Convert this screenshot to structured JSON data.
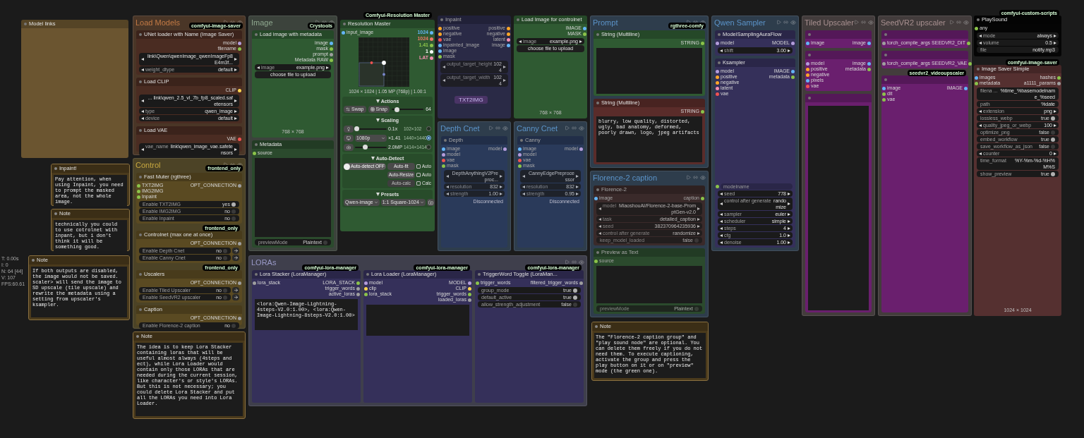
{
  "canvas_items": [
    {
      "kind": "node",
      "title": "Model links",
      "color": "#6b5530"
    },
    {
      "kind": "group",
      "title": "Load Models",
      "color": "#c27a45",
      "badge": "comfyui-image-saver",
      "nodes": [
        {
          "title": "UNet loader with Name (Image Saver)",
          "color": "#4a2c22",
          "outputs": [
            {
              "label": "model",
              "color": "#b39ddb"
            },
            {
              "label": "filename",
              "color": "#8bc34a"
            }
          ],
          "widgets": [
            {
              "kind": "combo",
              "value": "link\\Qwen\\qwenImage_qwenImageFp8E4m3f..."
            },
            {
              "kind": "combo",
              "label": "weight_dtype",
              "value": "default"
            }
          ]
        },
        {
          "title": "Load CLIP",
          "color": "#4a2c22",
          "outputs": [
            {
              "label": "CLIP",
              "color": "#ffd54f"
            }
          ],
          "widgets": [
            {
              "kind": "combo",
              "value": "... link\\qwen_2.5_vl_7b_fp8_scaled.safetensors"
            },
            {
              "kind": "combo",
              "label": "type",
              "value": "qwen_image"
            },
            {
              "kind": "combo",
              "label": "device",
              "value": "default"
            }
          ]
        },
        {
          "title": "Load VAE",
          "color": "#4a2c22",
          "outputs": [
            {
              "label": "VAE",
              "color": "#ef5350"
            }
          ],
          "widgets": [
            {
              "kind": "combo",
              "label": "vae_name",
              "value": "link\\qwen_image_vae.safetensors"
            }
          ]
        }
      ]
    },
    {
      "kind": "group",
      "title": "Image",
      "color": "#8fa88f",
      "badge": "Crystools",
      "nodes": [
        {
          "title": "Load image with metadata",
          "color": "#2f5a32",
          "outputs": [
            {
              "label": "image",
              "color": "#64b5f6"
            },
            {
              "label": "mask",
              "color": "#8bc34a"
            },
            {
              "label": "prompt",
              "color": "#9e9e9e"
            },
            {
              "label": "Metadata RAW",
              "color": "#8bc34a"
            }
          ],
          "widgets": [
            {
              "kind": "combo",
              "label": "image",
              "value": "example.png"
            },
            {
              "kind": "button",
              "label": "choose file to upload"
            }
          ],
          "footer": "768 × 768"
        },
        {
          "kind": "text",
          "title": "Metadata",
          "color": "#2b4a2d",
          "inputs": [
            {
              "label": "source",
              "color": "#8bc34a"
            }
          ],
          "bottom_widgets": [
            {
              "kind": "toggle",
              "label": "previewMode",
              "value": "Plaintext",
              "on": false
            }
          ]
        }
      ]
    },
    {
      "kind": "resolution_master",
      "title": "Resolution Master",
      "badge": "Comfyui-Resolution Master",
      "color": "#2f5a32",
      "inputs": [
        {
          "label": "input_image",
          "color": "#64b5f6"
        }
      ],
      "outputs": [
        {
          "label": "1024",
          "color": "#64b5f6"
        },
        {
          "label": "1024",
          "color": "#ef7a6a"
        },
        {
          "label": "1.41",
          "color": "#8bc34a"
        },
        {
          "label": "1",
          "color": "#ffffff"
        },
        {
          "label": "LAT",
          "color": "#f48fb1"
        }
      ],
      "info": "1024 × 1024 | 1.05 MP (768p) | 1.00:1",
      "actions": {
        "title": "Actions",
        "buttons": [
          "Swap",
          "Snap"
        ],
        "level": 0.15,
        "value": "64"
      },
      "scaling": {
        "title": "Scaling",
        "rows": [
          {
            "kind": "slider",
            "level": 0.05,
            "value": "0.1x",
            "dims": "102×102",
            "selected": false
          },
          {
            "kind": "dropdown",
            "option": "1080p",
            "value": "×1.41",
            "dims": "1440×1440",
            "selected": true
          },
          {
            "kind": "slider",
            "level": 0.3,
            "value": "2.0MP",
            "dims": "1414×1414",
            "selected": false
          }
        ]
      },
      "auto_detect": {
        "title": "Auto-Detect",
        "toggle": {
          "label": "Auto-detect OFF",
          "on": false
        },
        "buttons": [
          {
            "label": "Auto-fit",
            "checkbox": "Auto",
            "checked": false,
            "disabled": false
          },
          {
            "label": "Auto-Resize",
            "checkbox": "Auto",
            "checked": false,
            "disabled": false
          },
          {
            "label": "Auto-calc",
            "checkbox": "Calc",
            "checked": false,
            "disabled": true
          }
        ]
      },
      "presets": {
        "title": "Presets",
        "dropdowns": [
          "Qwen-image",
          "1:1 Square-1024"
        ]
      }
    },
    {
      "kind": "node",
      "title": "Inpaint",
      "color": "#2a2a46",
      "muted": true,
      "tag": "TXT2IMG",
      "inputs": [
        {
          "label": "positive",
          "color": "#ffa726"
        },
        {
          "label": "negative",
          "color": "#ffa726"
        },
        {
          "label": "vae",
          "color": "#ef5350"
        },
        {
          "label": "inpainted_image",
          "color": "#64b5f6"
        },
        {
          "label": "image",
          "color": "#64b5f6"
        },
        {
          "label": "mask",
          "color": "#8bc34a"
        }
      ],
      "outputs": [
        {
          "label": "positive",
          "color": "#ffa726"
        },
        {
          "label": "negative",
          "color": "#ffa726"
        },
        {
          "label": "latent",
          "color": "#f48fb1"
        },
        {
          "label": "image",
          "color": "#64b5f6"
        }
      ],
      "widgets": [
        {
          "kind": "number",
          "label": "output_target_height",
          "value": "1024"
        },
        {
          "kind": "number",
          "label": "output_target_width",
          "value": "1024"
        }
      ]
    },
    {
      "kind": "node",
      "title": "Load Image for controlnet",
      "color": "#2f5a32",
      "outputs": [
        {
          "label": "IMAGE",
          "color": "#64b5f6"
        },
        {
          "label": "MASK",
          "color": "#8bc34a"
        }
      ],
      "widgets": [
        {
          "kind": "combo",
          "label": "image",
          "value": "example.png"
        },
        {
          "kind": "button",
          "label": "choose file to upload"
        }
      ],
      "footer": "768 × 768"
    },
    {
      "kind": "group",
      "title": "Prompt",
      "color": "#5b93c8",
      "badge": "rgthree-comfy",
      "nodes": [
        {
          "kind": "text",
          "title": "String (Multiline)",
          "color": "#2f5a32",
          "outputs": [
            {
              "label": "STRING",
              "color": "#8bc34a"
            }
          ]
        },
        {
          "kind": "text",
          "title": "String (Multiline)",
          "color": "#5a2c2a",
          "outputs": [
            {
              "label": "STRING",
              "color": "#8bc34a"
            }
          ],
          "text": "blurry, low quality, distorted, ugly, bad anatomy, deformed, poorly drawn, logo, jpeg artifacts"
        }
      ]
    },
    {
      "kind": "group",
      "title": "Qwen Sampler",
      "color": "#5b93c8",
      "nodes": [
        {
          "title": "ModelSamplingAuraFlow",
          "color": "#35305a",
          "inputs": [
            {
              "label": "model",
              "color": "#b39ddb"
            }
          ],
          "outputs": [
            {
              "label": "MODEL",
              "color": "#b39ddb"
            }
          ],
          "widgets": [
            {
              "kind": "number",
              "label": "shift",
              "value": "3.00"
            }
          ]
        },
        {
          "title": "Ksampler",
          "color": "#35305a",
          "inputs": [
            {
              "label": "model",
              "color": "#b39ddb"
            },
            {
              "label": "positive",
              "color": "#ffa726"
            },
            {
              "label": "negative",
              "color": "#ffa726"
            },
            {
              "label": "latent",
              "color": "#f48fb1"
            },
            {
              "label": "vae",
              "color": "#ef5350"
            }
          ],
          "outputs": [
            {
              "label": "IMAGE",
              "color": "#64b5f6"
            },
            {
              "label": "metadata",
              "color": "#8bc34a"
            }
          ],
          "bottom_widgets": [
            {
              "kind": "socket",
              "label": "modelname",
              "color": "#8bc34a"
            },
            {
              "kind": "number",
              "label": "seed",
              "value": "778"
            },
            {
              "kind": "combo",
              "label": "control after generate",
              "value": "randomize"
            },
            {
              "kind": "combo",
              "label": "sampler",
              "value": "euler"
            },
            {
              "kind": "combo",
              "label": "scheduler",
              "value": "simple"
            },
            {
              "kind": "number",
              "label": "steps",
              "value": "4"
            },
            {
              "kind": "number",
              "label": "cfg",
              "value": "1.0"
            },
            {
              "kind": "number",
              "label": "denoise",
              "value": "1.00"
            }
          ]
        }
      ]
    },
    {
      "kind": "group",
      "title": "Tiled Upscaler",
      "color": "#a89090",
      "nodes": [
        {
          "bypassed": true,
          "inputs": [
            {
              "label": "image",
              "color": "#64b5f6"
            }
          ],
          "outputs": [
            {
              "label": "image",
              "color": "#64b5f6"
            }
          ]
        },
        {
          "bypassed": true,
          "inputs": [
            {
              "label": "model",
              "color": "#b39ddb"
            },
            {
              "label": "positive",
              "color": "#ffa726"
            },
            {
              "label": "negative",
              "color": "#ffa726"
            },
            {
              "label": "pixels",
              "color": "#64b5f6"
            },
            {
              "label": "vae",
              "color": "#ef5350"
            }
          ],
          "outputs": [
            {
              "label": "image",
              "color": "#64b5f6"
            },
            {
              "label": "metadata",
              "color": "#8bc34a"
            }
          ]
        },
        {
          "kind": "text",
          "bypassed": true
        }
      ]
    },
    {
      "kind": "group",
      "title": "SeedVR2 upscaler",
      "color": "#a89090",
      "nodes": [
        {
          "bypassed": true,
          "inputs": [
            {
              "label": "torch_compile_args",
              "color": "#9e9e9e"
            }
          ],
          "outputs": [
            {
              "label": "SEEDVR2_DIT",
              "color": "#8bc34a"
            }
          ]
        },
        {
          "bypassed": true,
          "inputs": [
            {
              "label": "torch_compile_args",
              "color": "#9e9e9e"
            }
          ],
          "outputs": [
            {
              "label": "SEEDVR2_VAE",
              "color": "#8bc34a"
            }
          ]
        },
        {
          "bypassed": true,
          "badge": "seedvr2_videoupscaler",
          "inputs": [
            {
              "label": "image",
              "color": "#64b5f6"
            },
            {
              "label": "dit",
              "color": "#8bc34a"
            },
            {
              "label": "vae",
              "color": "#8bc34a"
            }
          ],
          "outputs": [
            {
              "label": "IMAGE",
              "color": "#64b5f6"
            }
          ]
        }
      ]
    },
    {
      "kind": "node",
      "title": "PlaySound",
      "color": "#050505",
      "badge": "comfyui-custom-scripts",
      "inputs": [
        {
          "label": "any",
          "color": "#8bc34a"
        }
      ],
      "widgets": [
        {
          "kind": "combo",
          "label": "mode",
          "value": "always"
        },
        {
          "kind": "number",
          "label": "volume",
          "value": "0.5"
        },
        {
          "kind": "text",
          "label": "file",
          "value": "notify.mp3"
        }
      ]
    },
    {
      "kind": "node",
      "title": "Image Saver Simple",
      "color": "#553030",
      "badge": "comfyui-image-saver",
      "inputs": [
        {
          "label": "images",
          "color": "#64b5f6"
        },
        {
          "label": "metadata",
          "color": "#8bc34a"
        }
      ],
      "outputs": [
        {
          "label": "hashes",
          "color": "#8bc34a"
        },
        {
          "label": "a1111_params",
          "color": "#9e9e9e"
        }
      ],
      "widgets": [
        {
          "kind": "text",
          "label": "filena ...",
          "value": "%time_%basemodelname_%seed"
        },
        {
          "kind": "text",
          "label": "path",
          "value": "%date"
        },
        {
          "kind": "combo",
          "label": "extension",
          "value": "png"
        },
        {
          "kind": "toggle",
          "label": "lossless_webp",
          "value": "true",
          "on": true
        },
        {
          "kind": "number",
          "label": "quality_jpeg_or_webp",
          "value": "100"
        },
        {
          "kind": "toggle",
          "label": "optimize_png",
          "value": "false",
          "on": false
        },
        {
          "kind": "toggle",
          "label": "embed_workflow",
          "value": "true",
          "on": true
        },
        {
          "kind": "toggle",
          "label": "save_workflow_as_json",
          "value": "false",
          "on": false
        },
        {
          "kind": "number",
          "label": "counter",
          "value": "0"
        },
        {
          "kind": "text",
          "label": "time_format",
          "value": "%Y-%m-%d-%H%M%S"
        },
        {
          "kind": "toggle",
          "label": "show_preview",
          "value": "true",
          "on": true
        }
      ],
      "footer": "1024 × 1024"
    },
    {
      "kind": "group",
      "title": "Control",
      "color": "#c8a840",
      "badge": "frontend_only",
      "nodes": [
        {
          "title": "Fast Muter (rgthree)",
          "color": "#5a4a22",
          "inputs": [
            {
              "label": "TXT2IMG",
              "color": "#8bc34a"
            },
            {
              "label": "IMG2IMG",
              "color": "#8bc34a"
            },
            {
              "label": "Inpaint",
              "color": "#8bc34a"
            }
          ],
          "outputs": [
            {
              "label": "OPT_CONNECTION",
              "color": "#9e9e9e"
            }
          ],
          "widgets": [
            {
              "kind": "toggle",
              "label": "Enable TXT2IMG",
              "value": "yes",
              "on": true
            },
            {
              "kind": "toggle",
              "label": "Enable IMG2IMG",
              "value": "no",
              "on": false
            },
            {
              "kind": "toggle",
              "label": "Enable Inpaint",
              "value": "no",
              "on": false
            }
          ]
        },
        {
          "title": "Controlnet (max one at once)",
          "color": "#5a4a22",
          "badge": "frontend_only",
          "outputs": [
            {
              "label": "OPT_CONNECTION",
              "color": "#9e9e9e"
            }
          ],
          "widgets": [
            {
              "kind": "toggle_nav",
              "label": "Enable Depth Cnet",
              "value": "no",
              "on": false
            },
            {
              "kind": "toggle_nav",
              "label": "Enable Canny Cnet",
              "value": "no",
              "on": false
            }
          ]
        },
        {
          "title": "Uscalers",
          "color": "#5a4a22",
          "badge": "frontend_only",
          "outputs": [
            {
              "label": "OPT_CONNECTION",
              "color": "#9e9e9e"
            }
          ],
          "widgets": [
            {
              "kind": "toggle_nav",
              "label": "Enable Tiled Upscaler",
              "value": "no",
              "on": false
            },
            {
              "kind": "toggle_nav",
              "label": "Enable SeedVR2 upscaler",
              "value": "no",
              "on": false
            }
          ]
        },
        {
          "title": "Caption",
          "color": "#5a4a22",
          "outputs": [
            {
              "label": "OPT_CONNECTION",
              "color": "#9e9e9e"
            }
          ],
          "widgets": [
            {
              "kind": "toggle",
              "label": "Enable Florence-2 caption",
              "value": "no",
              "on": false
            }
          ]
        }
      ]
    },
    {
      "kind": "note",
      "title": "Inpaint!",
      "text": "Pay attention, when using Inpaint, you need to prompt the masked area, not the whole image."
    },
    {
      "kind": "note",
      "title": "Note",
      "text": "technically you could to use cotrolnet with inpant, but i don't think it will be something good."
    },
    {
      "kind": "stats",
      "lines": [
        "T: 0.00s",
        "I: 0",
        "N: 64 [44]",
        "V: 107",
        "FPS:60.61"
      ]
    },
    {
      "kind": "note",
      "title": "Note",
      "text": "If both outputs are disabled, the image would not be saved. scaler> will send the image to SD upscale (tile upscale) and rewrite the metadata using a setting from upscaler's ksampler."
    },
    {
      "kind": "group",
      "title": "Depth Cnet",
      "color": "#5b93c8",
      "nodes": [
        {
          "title": "Depth",
          "color": "#2a3a5a",
          "muted": true,
          "inputs": [
            {
              "label": "image",
              "color": "#64b5f6"
            },
            {
              "label": "model",
              "color": "#b39ddb"
            },
            {
              "label": "vae",
              "color": "#ef5350"
            },
            {
              "label": "mask",
              "color": "#8bc34a"
            }
          ],
          "outputs": [
            {
              "label": "model",
              "color": "#b39ddb"
            }
          ],
          "widgets": [
            {
              "kind": "combo",
              "value": "DepthAnythingV2Preproc..."
            },
            {
              "kind": "number",
              "label": "resolution",
              "value": "832"
            },
            {
              "kind": "number",
              "label": "strength",
              "value": "1.00"
            }
          ],
          "status": "Disconnected"
        }
      ]
    },
    {
      "kind": "group",
      "title": "Canny Cnet",
      "color": "#5b93c8",
      "nodes": [
        {
          "title": "Canny",
          "color": "#2a3a5a",
          "muted": true,
          "inputs": [
            {
              "label": "image",
              "color": "#64b5f6"
            },
            {
              "label": "model",
              "color": "#b39ddb"
            },
            {
              "label": "vae",
              "color": "#ef5350"
            },
            {
              "label": "mask",
              "color": "#8bc34a"
            }
          ],
          "outputs": [
            {
              "label": "model",
              "color": "#b39ddb"
            }
          ],
          "widgets": [
            {
              "kind": "combo",
              "value": "CannyEdgePreprocessor"
            },
            {
              "kind": "number",
              "label": "resolution",
              "value": "832"
            },
            {
              "kind": "number",
              "label": "strength",
              "value": "0.95"
            }
          ],
          "status": "Disconnected"
        }
      ]
    },
    {
      "kind": "group",
      "title": "Florence-2 caption",
      "color": "#5b93c8",
      "nodes": [
        {
          "title": "Florence-2",
          "color": "#3a2a2a",
          "muted": true,
          "inputs": [
            {
              "label": "image",
              "color": "#64b5f6"
            }
          ],
          "outputs": [
            {
              "label": "caption",
              "color": "#8bc34a"
            }
          ],
          "widgets": [
            {
              "kind": "combo",
              "label": "model",
              "value": "MiaoshouAI/Florence-2-base-PromptGen-v2.0"
            },
            {
              "kind": "combo",
              "label": "task",
              "value": "detailed_caption"
            },
            {
              "kind": "number",
              "label": "seed",
              "value": "382370964235936"
            },
            {
              "kind": "combo",
              "label": "control after generate",
              "value": "randomize"
            },
            {
              "kind": "toggle",
              "label": "keep_model_loaded",
              "value": "false",
              "on": false
            }
          ]
        },
        {
          "kind": "text",
          "title": "Preview as Text",
          "color": "#2b4a2d",
          "muted": true,
          "inputs": [
            {
              "label": "source",
              "color": "#8bc34a"
            }
          ],
          "bottom_widgets": [
            {
              "kind": "toggle",
              "label": "previewMode",
              "value": "Plaintext",
              "on": false
            }
          ]
        }
      ]
    },
    {
      "kind": "group",
      "title": "LORAs",
      "color": "#9a9ac8",
      "nodes": [
        {
          "kind": "text",
          "title": "Lora Stacker (LoraManager)",
          "color": "#35305a",
          "badge": "comfyui-lora-manager",
          "inputs": [
            {
              "label": "lora_stack",
              "color": "#9e9e9e"
            }
          ],
          "outputs": [
            {
              "label": "LORA_STACK",
              "color": "#8bc34a"
            },
            {
              "label": "trigger_words",
              "color": "#9e9e9e"
            },
            {
              "label": "active_loras",
              "color": "#9e9e9e"
            }
          ],
          "text": "<lora:Qwen-Image-Lightning-4steps-V2.0:1.00>, <lora:Qwen-Image-Lightning-8steps-V2.0:1.00>"
        },
        {
          "kind": "text",
          "title": "Lora Loader (LoraManager)",
          "color": "#35305a",
          "badge": "comfyui-lora-manager",
          "inputs": [
            {
              "label": "model",
              "color": "#b39ddb"
            },
            {
              "label": "clip",
              "color": "#ffd54f"
            },
            {
              "label": "lora_stack",
              "color": "#8bc34a"
            }
          ],
          "outputs": [
            {
              "label": "MODEL",
              "color": "#b39ddb"
            },
            {
              "label": "CLIP",
              "color": "#ffd54f"
            },
            {
              "label": "trigger_words",
              "color": "#8bc34a"
            },
            {
              "label": "loaded_loras",
              "color": "#9e9e9e"
            }
          ]
        },
        {
          "title": "TriggerWord Toggle (LoraMan...",
          "color": "#35305a",
          "badge": "comfyui-lora-manager",
          "inputs": [
            {
              "label": "trigger_words",
              "color": "#8bc34a"
            }
          ],
          "outputs": [
            {
              "label": "filtered_trigger_words",
              "color": "#9e9e9e"
            }
          ],
          "widgets": [
            {
              "kind": "toggle",
              "label": "group_mode",
              "value": "true",
              "on": true
            },
            {
              "kind": "toggle",
              "label": "default_active",
              "value": "true",
              "on": true
            },
            {
              "kind": "toggle",
              "label": "allow_strength_adjustment",
              "value": "false",
              "on": false
            }
          ]
        }
      ]
    },
    {
      "kind": "note",
      "title": "Note",
      "text": "The idea is to keep Lora Stacker containing loras that will be useful almost always (4steps and ect), while Lora Loader would contain only those LORAs that are needed during the current session, like character's or style's LORAs. But this is not necessary; you could delete Lora Stacker and put all the LORAs you need into Lora Loader."
    },
    {
      "kind": "note",
      "title": "Note",
      "text": "The \"Florence-2 caption group\" and \"play sound node\" are optional. You can delete them freely if you do not need them. To execute captioning, activate the group and press the play button on it or on \"preview\" mode (the green one)."
    }
  ]
}
